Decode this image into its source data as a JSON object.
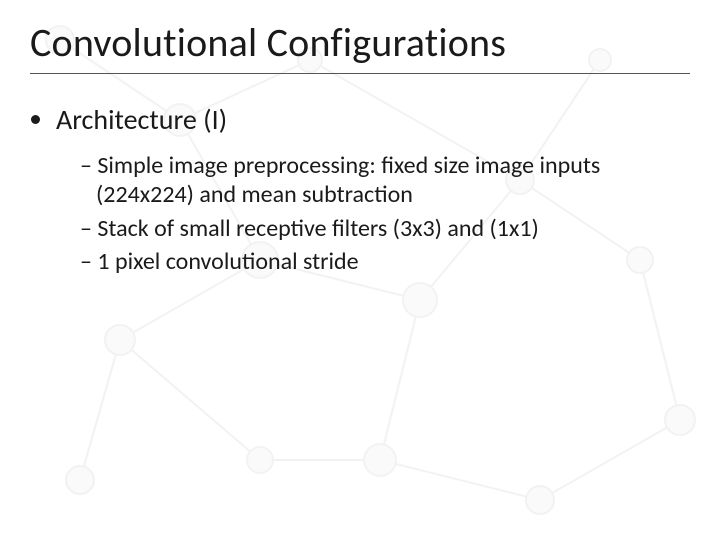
{
  "title": "Convolutional Configurations",
  "bullet1": "Architecture (I)",
  "sub1": "Simple image preprocessing: fixed size image inputs (224x224) and mean subtraction",
  "sub2": "Stack of small receptive filters (3x3) and (1x1)",
  "sub3": "1 pixel convolutional stride"
}
